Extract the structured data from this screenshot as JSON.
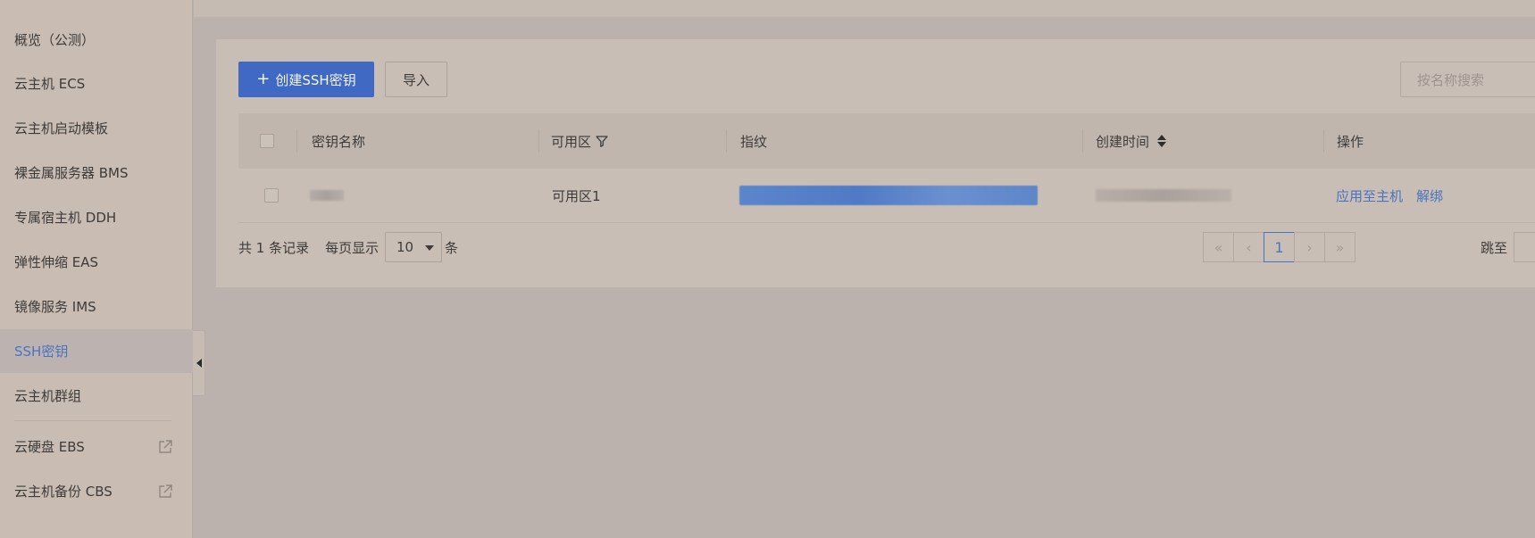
{
  "sidebar": {
    "items": [
      {
        "label": "概览（公测）"
      },
      {
        "label": "云主机 ECS"
      },
      {
        "label": "云主机启动模板"
      },
      {
        "label": "裸金属服务器 BMS"
      },
      {
        "label": "专属宿主机 DDH"
      },
      {
        "label": "弹性伸缩 EAS"
      },
      {
        "label": "镜像服务 IMS"
      },
      {
        "label": "SSH密钥",
        "active": true
      },
      {
        "label": "云主机群组"
      },
      {
        "label": "云硬盘 EBS",
        "external": true
      },
      {
        "label": "云主机备份 CBS",
        "external": true
      }
    ]
  },
  "toolbar": {
    "create_label": "创建SSH密钥",
    "import_label": "导入",
    "search_placeholder": "按名称搜索"
  },
  "table": {
    "columns": {
      "name": "密钥名称",
      "zone": "可用区",
      "fingerprint": "指纹",
      "created": "创建时间",
      "actions": "操作"
    },
    "rows": [
      {
        "zone": "可用区1",
        "action_apply": "应用至主机",
        "action_unbind": "解绑"
      }
    ]
  },
  "pagination": {
    "total_text": "共 1 条记录",
    "per_page_label": "每页显示",
    "per_page_value": "10",
    "per_page_unit": "条",
    "current_page": "1",
    "jump_label": "跳至"
  },
  "colors": {
    "primary": "#3f69c2",
    "link": "#4a73c0"
  }
}
